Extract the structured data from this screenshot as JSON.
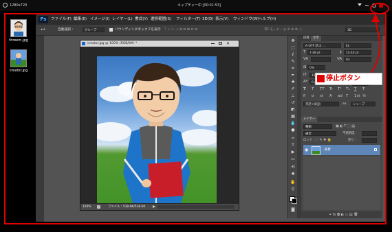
{
  "capture_bar": {
    "resolution": "1280x720",
    "title": "キャプチャー中 [00:01:53]"
  },
  "desktop": {
    "icons": [
      {
        "label": "threem.jpg"
      },
      {
        "label": "creator.jpg"
      }
    ]
  },
  "photoshop": {
    "logo": "Ps",
    "menu": [
      "ファイル(F)",
      "編集(E)",
      "イメージ(I)",
      "レイヤー(L)",
      "書式(Y)",
      "選択範囲(S)",
      "フィルター(T)",
      "3D(D)",
      "表示(V)",
      "ウィンドウ(W)",
      "ヘルプ(H)"
    ],
    "options": {
      "auto_select": "自動選択 :",
      "group": "グループ",
      "bbox": "バウンディングボックスを表示",
      "mode3d": "3D モード :",
      "workspace": "3D"
    },
    "document": {
      "title": "creator.jpg @ 100% (RGB/8#) *",
      "zoom": "100%",
      "file_info": "ファイル : 538.6K/538.6K"
    },
    "char_panel": {
      "tabs": [
        "段落",
        "文字"
      ],
      "font": "A-OTF 新ゴ ...",
      "style": "EL",
      "size": "7.48 pt",
      "leading": "14.43 pt",
      "tracking_label": "VA",
      "tracking": "63",
      "percent": "0%",
      "scale_v": "100%",
      "scale_h": "100%",
      "baseline": "0 pt",
      "color_label": "カラー :",
      "styles": [
        "T",
        "T",
        "TT",
        "Tr",
        "T¹",
        "T₁",
        "T",
        "Ŧ"
      ],
      "opentype": [
        "fi",
        "ơ",
        "st",
        "A",
        "ad",
        "T",
        "1st",
        "½"
      ],
      "language": "英語 (米国)",
      "aa_label": "aa",
      "antialias": "シャープ"
    },
    "layers_panel": {
      "tab": "レイヤー",
      "kind": "種類",
      "blend": "通常",
      "opacity_label": "不透明度 :",
      "lock_label": "ロック :",
      "fill_label": "塗り :",
      "layers": [
        {
          "name": "背景"
        }
      ]
    }
  },
  "annotation": {
    "text": "停止ボタン",
    "color": "#e00000"
  },
  "colors": {
    "accent_red": "#e00000",
    "ps_bg": "#535353",
    "menubar": "#2d2d2d"
  }
}
